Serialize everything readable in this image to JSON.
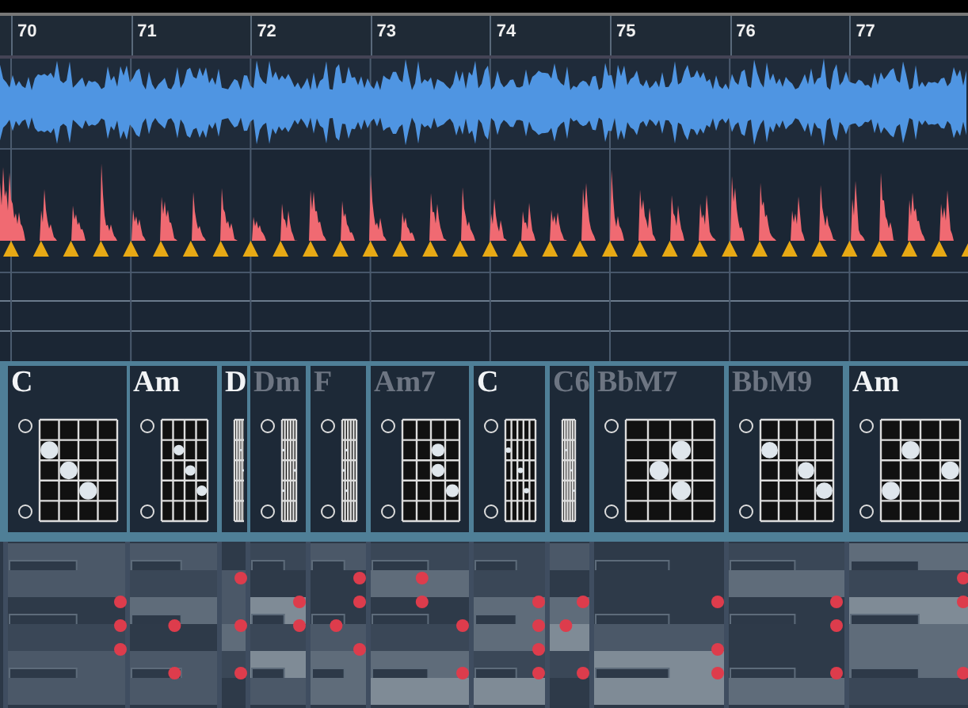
{
  "ruler": {
    "bars": [
      "70",
      "71",
      "72",
      "73",
      "74",
      "75",
      "76",
      "77"
    ]
  },
  "chord_track": {
    "chords": [
      {
        "name": "C",
        "dimmed": false
      },
      {
        "name": "Am",
        "dimmed": false
      },
      {
        "name": "D",
        "dimmed": false
      },
      {
        "name": "Dm",
        "dimmed": true
      },
      {
        "name": "F",
        "dimmed": true
      },
      {
        "name": "Am7",
        "dimmed": true
      },
      {
        "name": "C",
        "dimmed": false
      },
      {
        "name": "C6",
        "dimmed": true
      },
      {
        "name": "BbM7",
        "dimmed": true
      },
      {
        "name": "BbM9",
        "dimmed": true
      },
      {
        "name": "Am",
        "dimmed": false
      }
    ]
  }
}
